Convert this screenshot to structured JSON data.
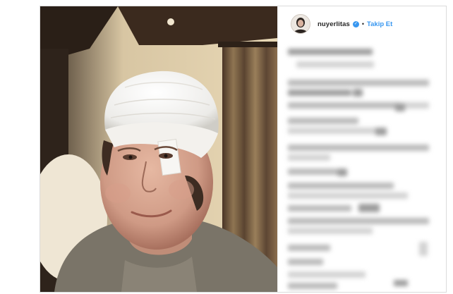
{
  "post": {
    "username": "nuyerlitas",
    "separator": "•",
    "follow_label": "Takip Et",
    "verified_icon": "verified-badge-icon"
  },
  "colors": {
    "link_blue": "#3897f0",
    "border": "#dbdbdb"
  }
}
